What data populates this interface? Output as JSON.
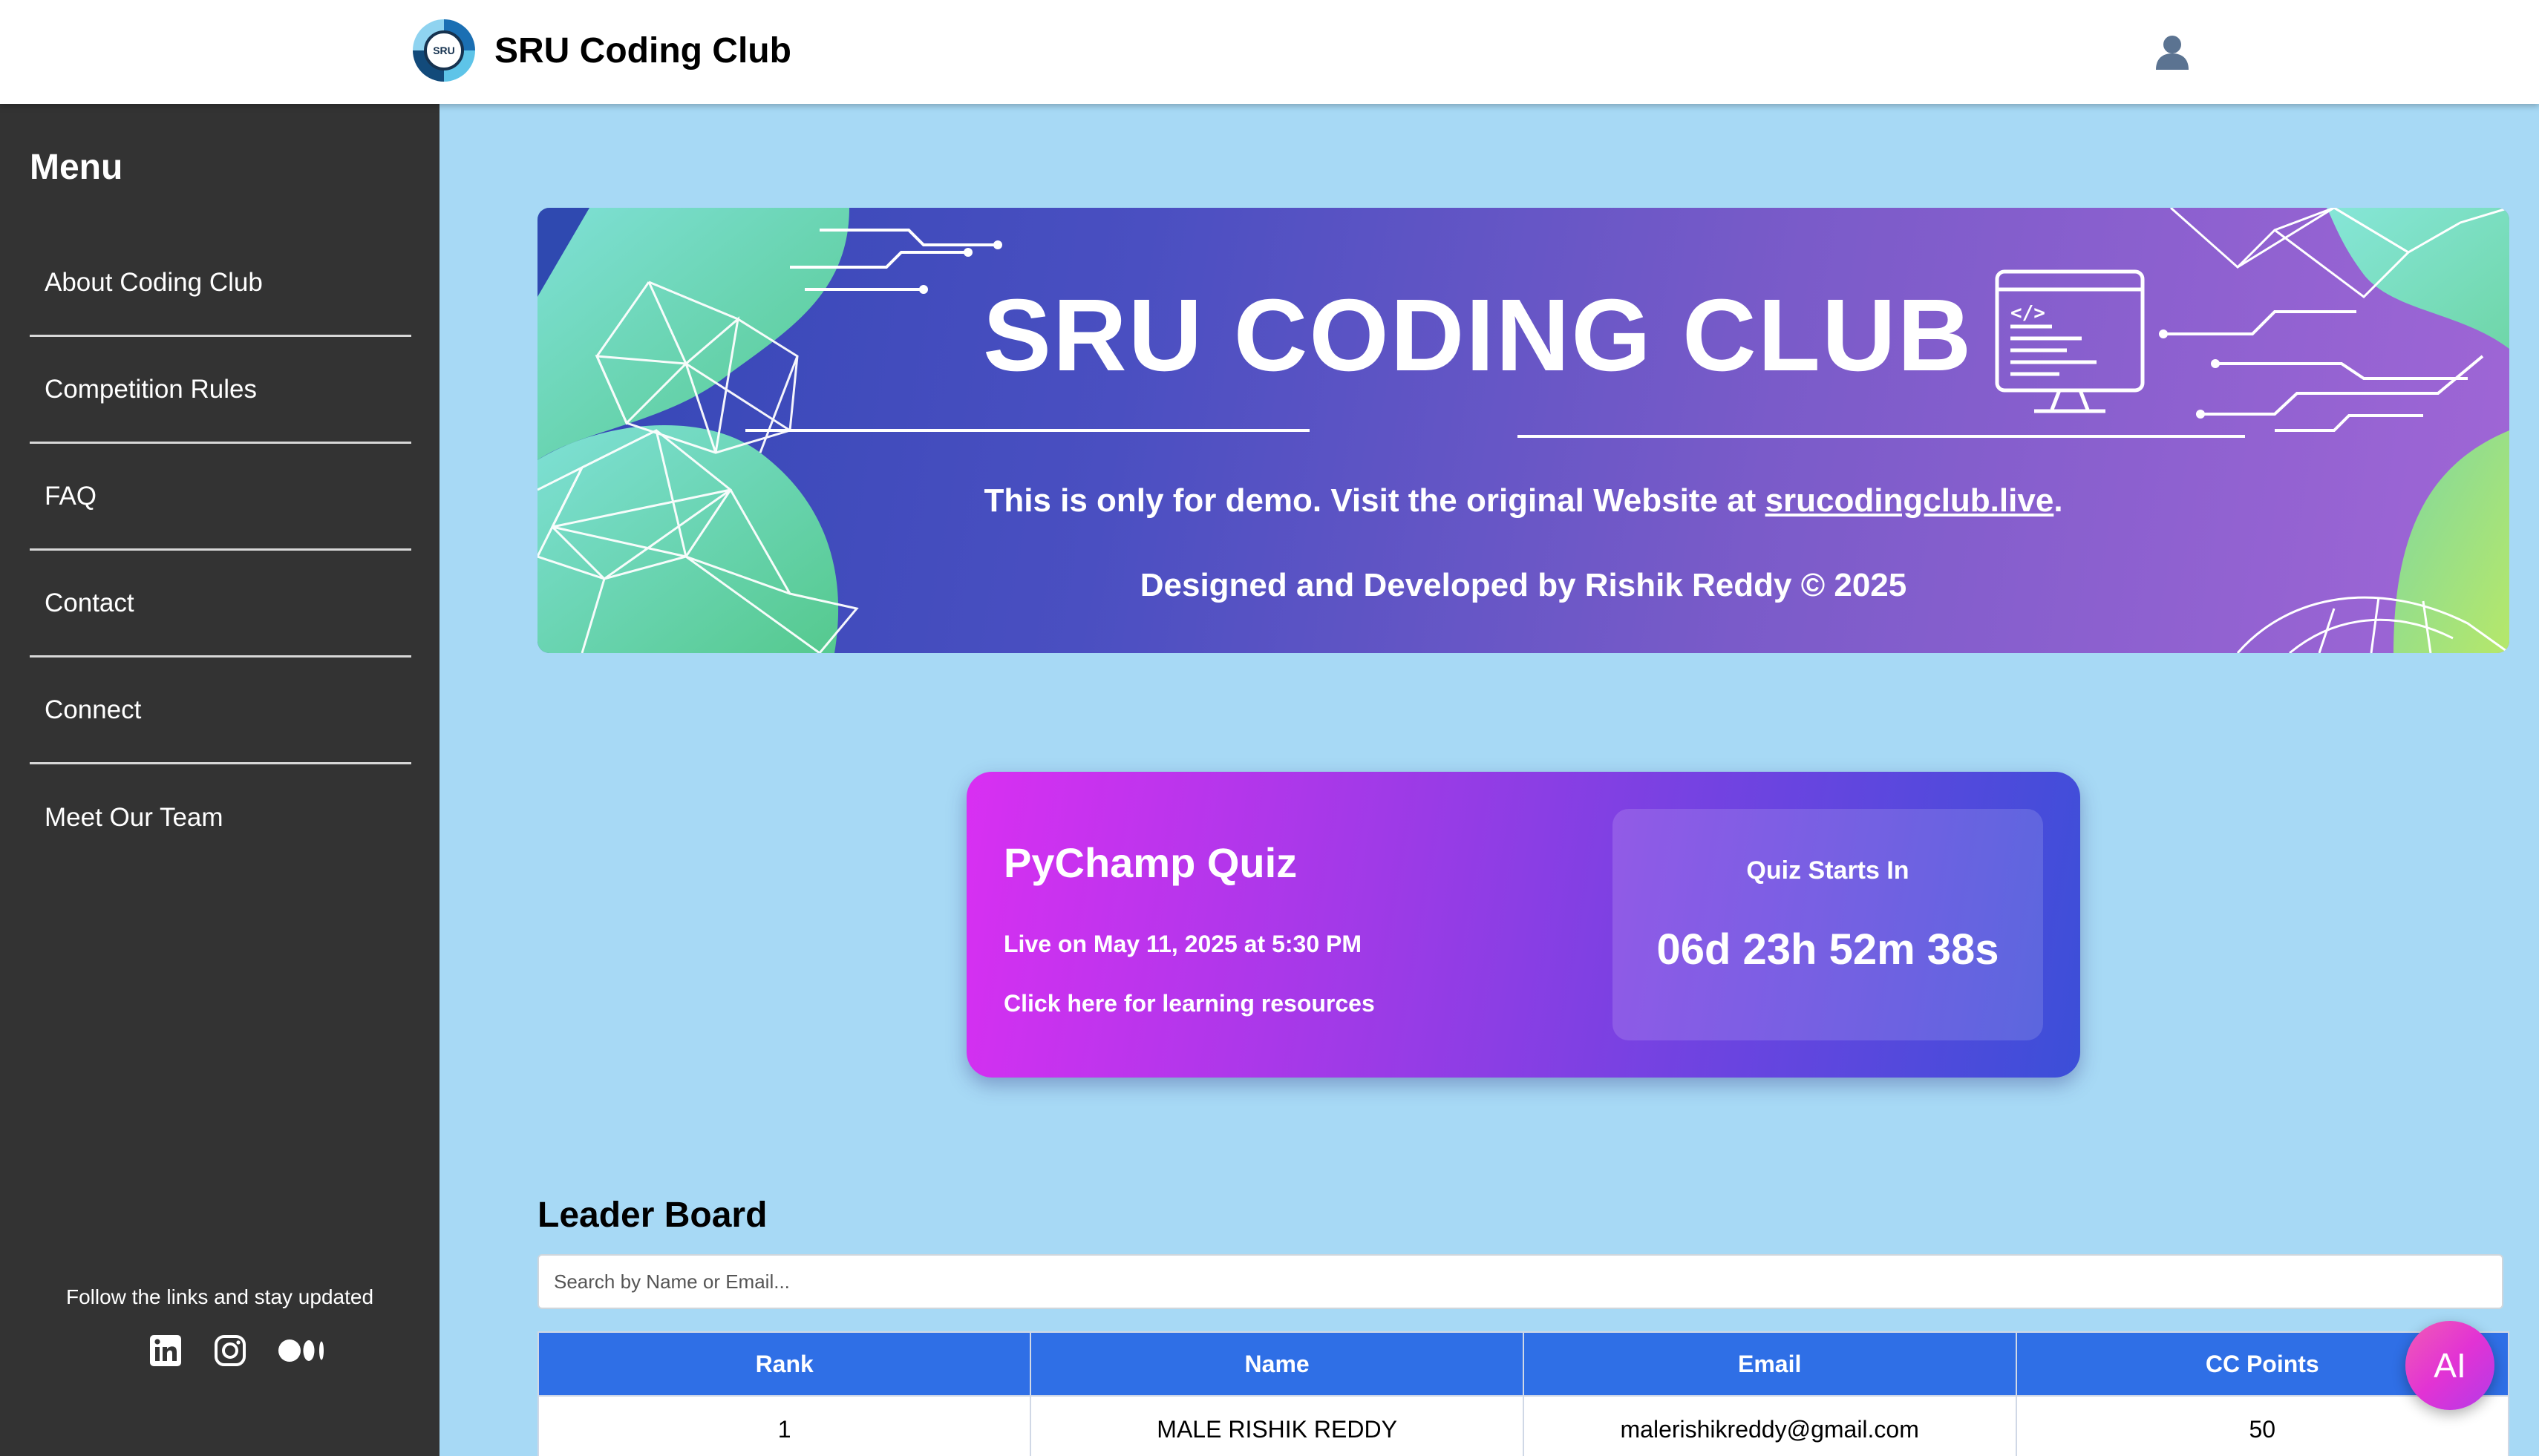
{
  "header": {
    "site_title": "SRU Coding Club",
    "logo_text": "SRU"
  },
  "sidebar": {
    "title": "Menu",
    "items": [
      {
        "label": "About Coding Club"
      },
      {
        "label": "Competition Rules"
      },
      {
        "label": "FAQ"
      },
      {
        "label": "Contact"
      },
      {
        "label": "Connect"
      },
      {
        "label": "Meet Our Team"
      }
    ],
    "follow_text": "Follow the links and stay updated",
    "social_icons": [
      "linkedin-icon",
      "instagram-icon",
      "medium-icon"
    ]
  },
  "banner": {
    "title": "SRU CODING CLUB",
    "line1_text": "This is only for demo. Visit the original Website at ",
    "line1_link": "srucodingclub.live",
    "line1_end": ".",
    "line2": "Designed and Developed by Rishik Reddy © 2025"
  },
  "quiz": {
    "name": "PyChamp Quiz",
    "live_text": "Live on May 11, 2025 at 5:30 PM",
    "resources_link": "Click here for learning resources",
    "countdown_label": "Quiz Starts In",
    "countdown_value": "06d 23h 52m 38s"
  },
  "leaderboard": {
    "title": "Leader Board",
    "search_placeholder": "Search by Name or Email...",
    "columns": [
      "Rank",
      "Name",
      "Email",
      "CC Points"
    ],
    "rows": [
      {
        "rank": "1",
        "name": "MALE RISHIK REDDY",
        "email": "malerishikreddy@gmail.com",
        "points": "50"
      }
    ]
  },
  "ai_button": {
    "label": "AI"
  },
  "colors": {
    "page_bg": "#a7d9f5",
    "sidebar_bg": "#333333",
    "table_header": "#2f6fe6",
    "quiz_gradient_start": "#d92ff2",
    "quiz_gradient_end": "#3b4fd8"
  }
}
